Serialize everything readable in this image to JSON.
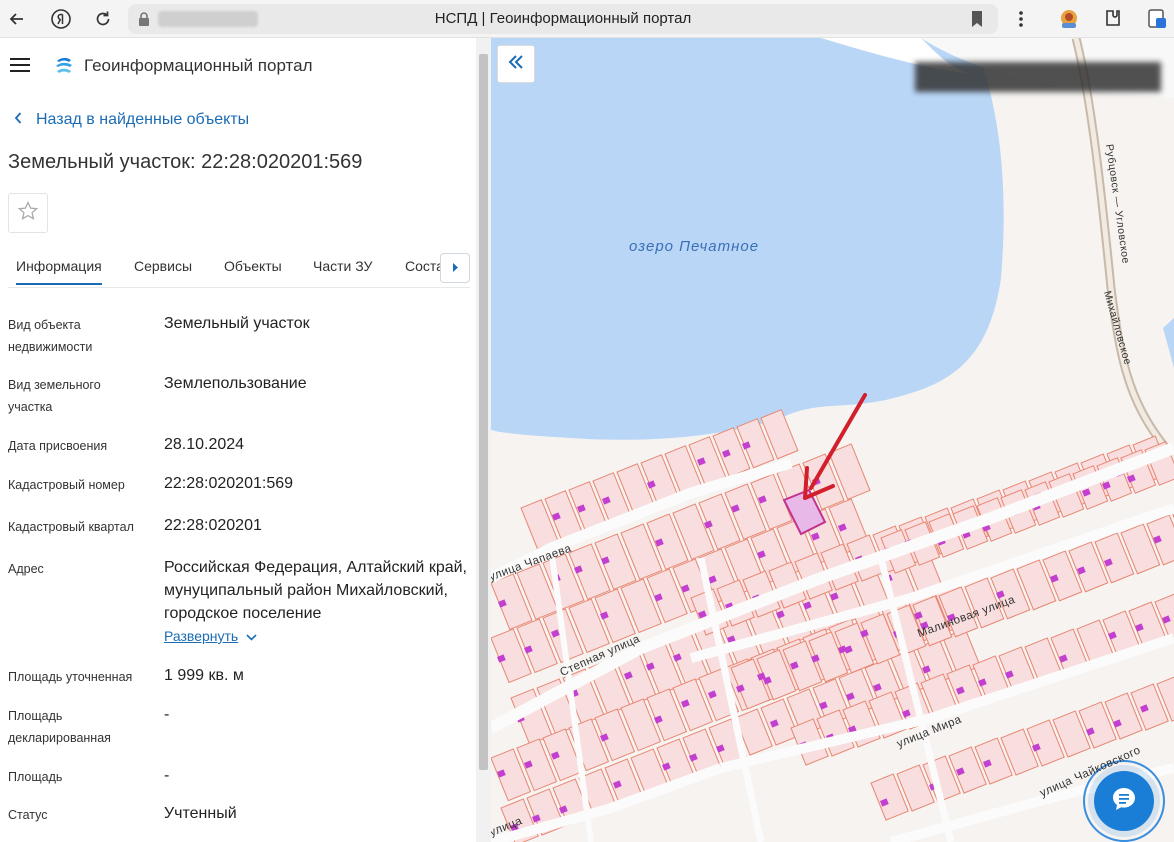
{
  "browser": {
    "tab_title": "НСПД | Геоинформационный портал"
  },
  "header": {
    "portal_name": "Геоинформационный портал"
  },
  "nav": {
    "back_label": "Назад в найденные объекты"
  },
  "object": {
    "title": "Земельный участок: 22:28:020201:569"
  },
  "tabs": [
    {
      "label": "Информация",
      "active": true
    },
    {
      "label": "Сервисы"
    },
    {
      "label": "Объекты"
    },
    {
      "label": "Части ЗУ"
    },
    {
      "label": "Соста"
    }
  ],
  "info": {
    "rows": [
      {
        "label": "Вид объекта недвижимости",
        "value": "Земельный участок"
      },
      {
        "label": "Вид земельного участка",
        "value": "Землепользование"
      },
      {
        "label": "Дата присвоения",
        "value": "28.10.2024"
      },
      {
        "label": "Кадастровый номер",
        "value": "22:28:020201:569"
      },
      {
        "label": "Кадастровый квартал",
        "value": "22:28:020201"
      },
      {
        "label": "Адрес",
        "value": "Российская Федерация, Алтайский край, мунуципальный район Михайловский, городское поселение"
      },
      {
        "label": "Площадь уточненная",
        "value": "1 999 кв. м"
      },
      {
        "label": "Площадь декларированная",
        "value": "-"
      },
      {
        "label": "Площадь",
        "value": "-"
      },
      {
        "label": "Статус",
        "value": "Учтенный"
      }
    ],
    "expand_label": "Развернуть"
  },
  "map": {
    "lake_label": "озеро Печатное",
    "streets": {
      "chapaeva": "улица Чапаева",
      "stepnaya": "Степная улица",
      "malinovaya": "Малиновая улица",
      "mira": "улица Мира",
      "chaykovskogo": "улица Чайковского",
      "road": "Рубцовск — Угловское",
      "mikhaylovskoe": "Михайловское",
      "bottom": "улица"
    },
    "colors": {
      "water": "#b9d6f7",
      "parcel_fill": "#f8dede",
      "parcel_stroke": "#e88672",
      "building": "#c23fd0",
      "selected": "#c3328d",
      "arrow": "#d21f2b"
    }
  }
}
